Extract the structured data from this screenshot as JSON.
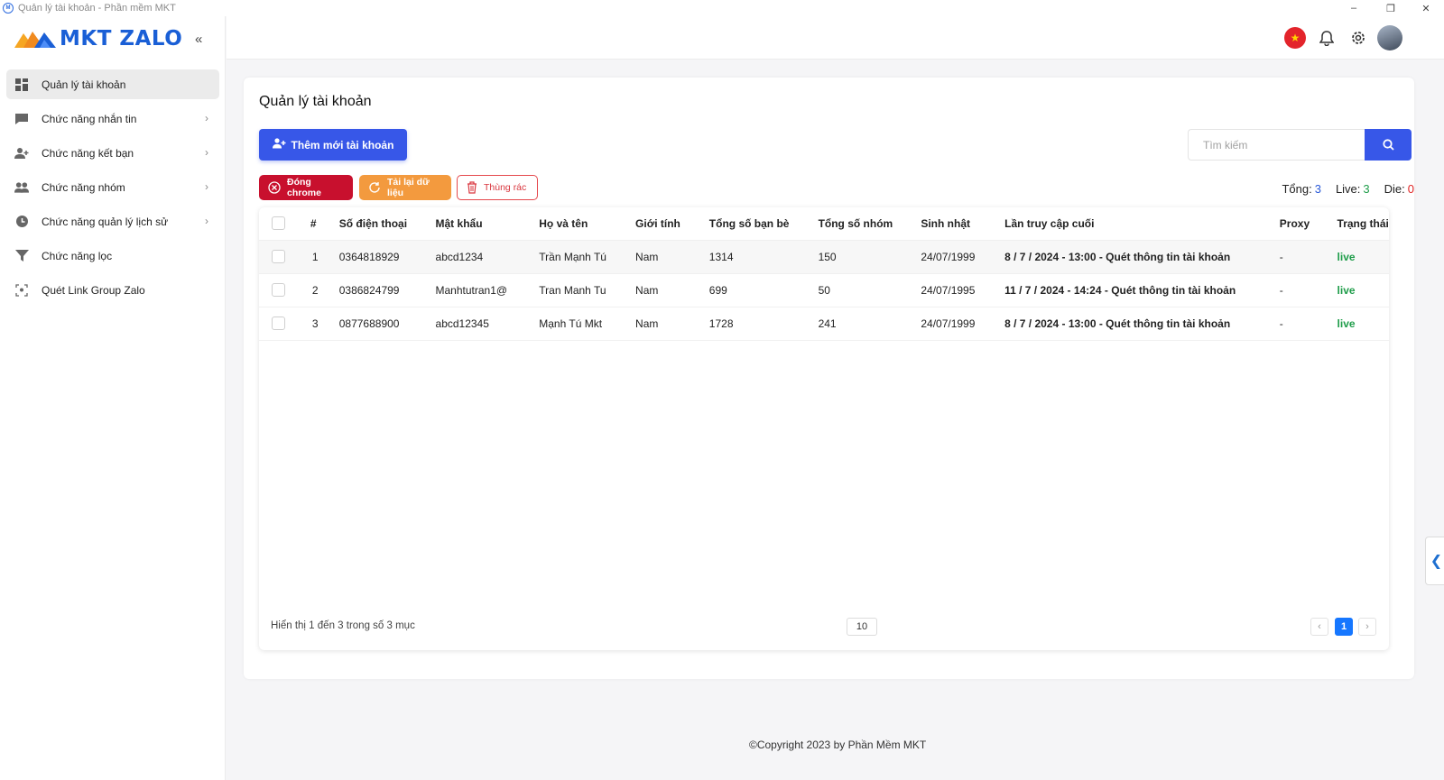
{
  "window": {
    "title": "Quản lý tài khoản - Phần mềm MKT",
    "controls": {
      "minimize": "–",
      "restore": "❐",
      "close": "✕"
    }
  },
  "brand": {
    "name": "MKT ZALO",
    "color": "#1a5fd6"
  },
  "sidebar": {
    "collapse_icon": "«",
    "items": [
      {
        "label": "Quản lý tài khoản",
        "icon": "grid-icon",
        "active": true
      },
      {
        "label": "Chức năng nhắn tin",
        "icon": "chat-icon"
      },
      {
        "label": "Chức năng kết bạn",
        "icon": "add-friend-icon"
      },
      {
        "label": "Chức năng nhóm",
        "icon": "group-icon"
      },
      {
        "label": "Chức năng quản lý lịch sử",
        "icon": "history-icon"
      },
      {
        "label": "Chức năng lọc",
        "icon": "filter-icon"
      },
      {
        "label": "Quét Link Group Zalo",
        "icon": "scan-icon"
      }
    ]
  },
  "header": {
    "icons": [
      "vietnam-flag-icon",
      "bell-icon",
      "gear-icon",
      "avatar"
    ]
  },
  "page": {
    "title": "Quản lý tài khoản",
    "add_button": "Thêm mới tài khoản",
    "search_placeholder": "Tìm kiếm",
    "actions": {
      "close_chrome": "Đóng chrome",
      "reload": "Tải lại dữ liệu",
      "trash": "Thùng rác"
    },
    "stats": {
      "total_label": "Tổng:",
      "total": "3",
      "live_label": "Live:",
      "live": "3",
      "die_label": "Die:",
      "die": "0"
    }
  },
  "table": {
    "columns": [
      "#",
      "Số điện thoại",
      "Mật khẩu",
      "Họ và tên",
      "Giới tính",
      "Tổng số bạn bè",
      "Tổng số nhóm",
      "Sinh nhật",
      "Lần truy cập cuối",
      "Proxy",
      "Trạng thái"
    ],
    "rows": [
      {
        "idx": "1",
        "phone": "0364818929",
        "password": "abcd1234",
        "name": "Trần Mạnh Tú",
        "gender": "Nam",
        "friends": "1314",
        "groups": "150",
        "birthday": "24/07/1999",
        "last_access": "8 / 7 / 2024 - 13:00 - Quét thông tin tài khoản",
        "proxy": "-",
        "status": "live"
      },
      {
        "idx": "2",
        "phone": "0386824799",
        "password": "Manhtutran1@",
        "name": "Tran Manh Tu",
        "gender": "Nam",
        "friends": "699",
        "groups": "50",
        "birthday": "24/07/1995",
        "last_access": "11 / 7 / 2024 - 14:24 - Quét thông tin tài khoản",
        "proxy": "-",
        "status": "live"
      },
      {
        "idx": "3",
        "phone": "0877688900",
        "password": "abcd12345",
        "name": "Mạnh Tú Mkt",
        "gender": "Nam",
        "friends": "1728",
        "groups": "241",
        "birthday": "24/07/1999",
        "last_access": "8 / 7 / 2024 - 13:00 - Quét thông tin tài khoản",
        "proxy": "-",
        "status": "live"
      }
    ],
    "footer": {
      "summary": "Hiển thị 1 đến 3 trong số 3 mục",
      "page_size": "10",
      "prev": "‹",
      "current_page": "1",
      "next": "›"
    }
  },
  "copyright": "©Copyright 2023 by Phần Mềm MKT",
  "side_tab_icon": "❮"
}
